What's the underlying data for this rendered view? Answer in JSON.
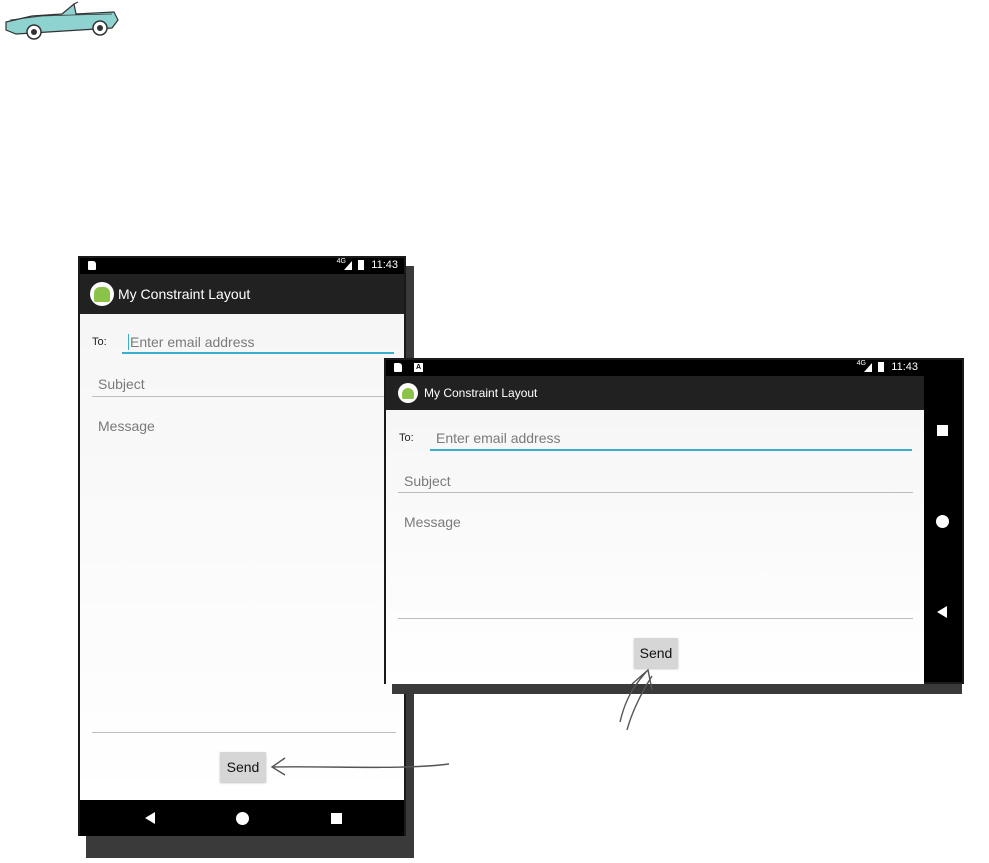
{
  "portrait": {
    "status_time": "11:43",
    "status_signal": "4G",
    "app_title": "My Constraint Layout",
    "to_label": "To:",
    "email_placeholder": "Enter email address",
    "subject_placeholder": "Subject",
    "message_placeholder": "Message",
    "send_label": "Send"
  },
  "landscape": {
    "status_time": "11:43",
    "status_signal": "4G",
    "status_a_icon": "A",
    "app_title": "My Constraint Layout",
    "to_label": "To:",
    "email_placeholder": "Enter email address",
    "subject_placeholder": "Subject",
    "message_placeholder": "Message",
    "send_label": "Send"
  },
  "icons": {
    "car": "car-illustration",
    "back": "back-triangle-icon",
    "home": "home-circle-icon",
    "recents": "recents-square-icon",
    "sd_card": "sd-card-icon",
    "signal": "signal-icon",
    "battery": "battery-icon",
    "app_logo": "android-logo-icon"
  },
  "colors": {
    "accent": "#3aaecb",
    "app_bar": "#212121",
    "status_bar": "#000000",
    "button": "#d6d6d6",
    "avatar_green": "#8bc34a"
  }
}
